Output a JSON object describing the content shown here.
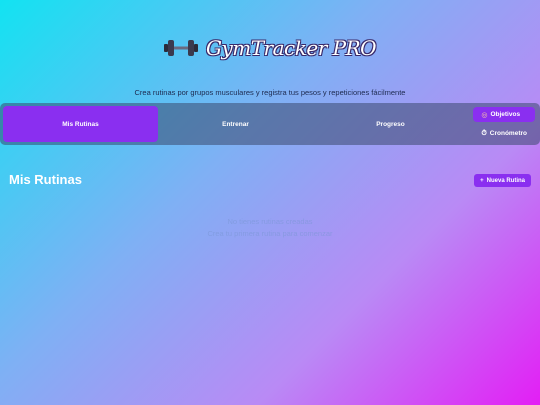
{
  "header": {
    "title": "GymTracker PRO",
    "logo_icon": "dumbbell-icon",
    "subtitle": "Crea rutinas por grupos musculares y registra tus pesos y repeticiones fácilmente"
  },
  "nav": {
    "tabs": [
      {
        "label": "Mis Rutinas",
        "active": true
      },
      {
        "label": "Entrenar",
        "active": false
      },
      {
        "label": "Progreso",
        "active": false
      }
    ],
    "side_buttons": [
      {
        "label": "Objetivos",
        "icon": "target-icon",
        "glyph": "◎"
      },
      {
        "label": "Cronómetro",
        "icon": "stopwatch-icon",
        "glyph": "⏱"
      }
    ]
  },
  "main": {
    "section_title": "Mis Rutinas",
    "new_button_label": "Nueva Rutina",
    "new_button_icon": "+",
    "empty_line1": "No tienes rutinas creadas",
    "empty_line2": "Crea tu primera rutina para comenzar"
  },
  "colors": {
    "accent": "#8a2ff0",
    "gradient_start": "#12e3f2",
    "gradient_end": "#e31ef5"
  }
}
